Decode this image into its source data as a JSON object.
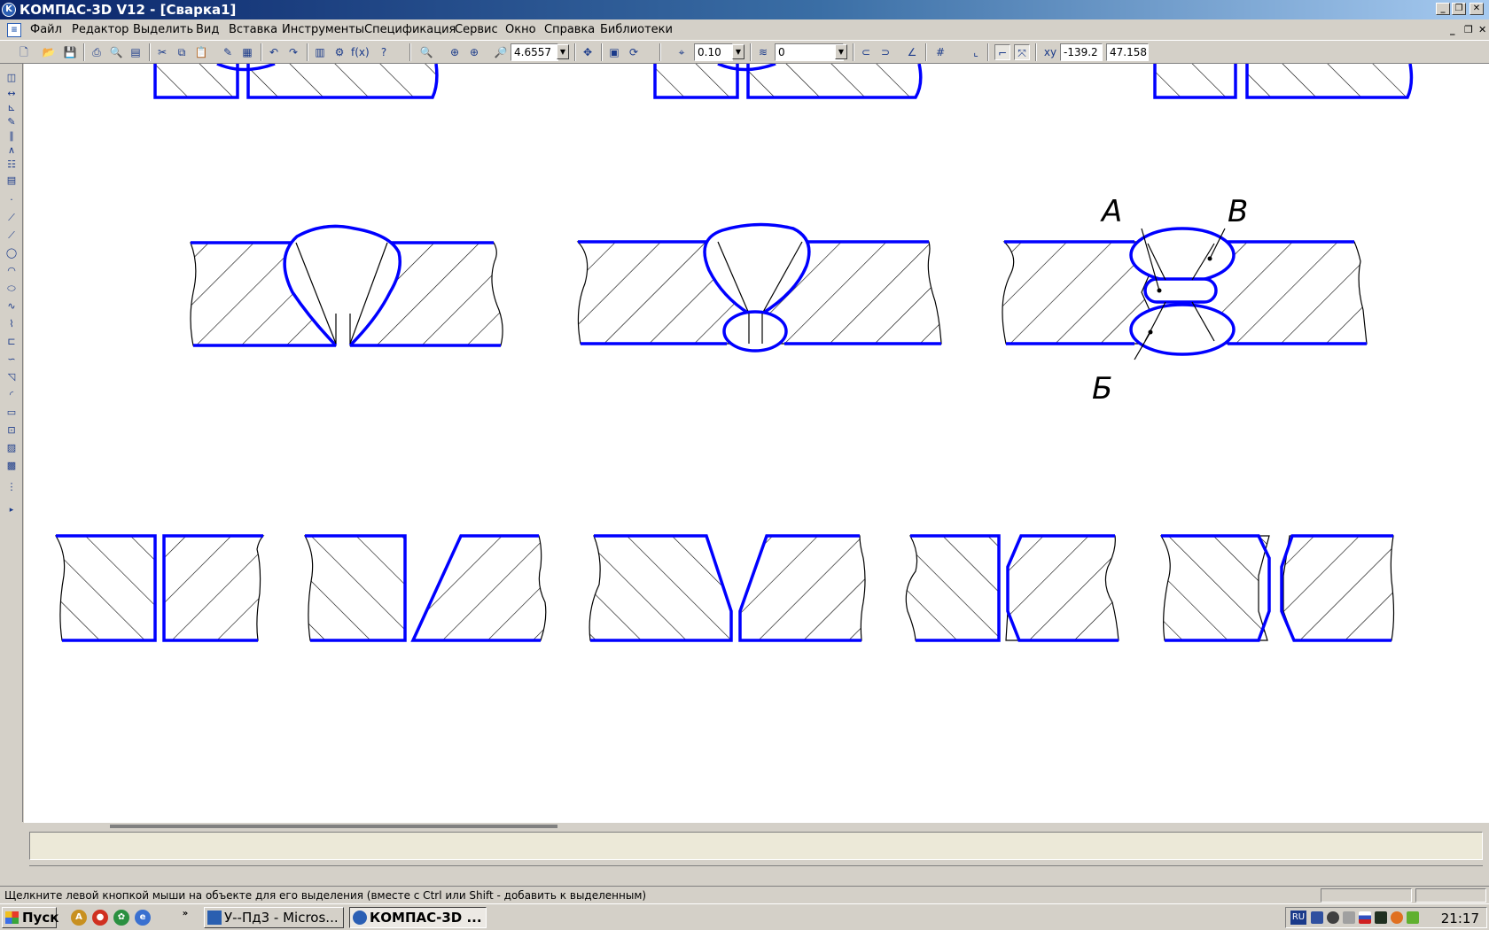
{
  "window": {
    "title": "КОМПАС-3D V12 - [Сварка1]",
    "app_icon": "kompas-logo-icon",
    "controls": [
      "minimize-icon",
      "restore-icon",
      "close-icon"
    ]
  },
  "menu": {
    "items": [
      "Файл",
      "Редактор",
      "Выделить",
      "Вид",
      "Вставка",
      "Инструменты",
      "Спецификация",
      "Сервис",
      "Окно",
      "Справка",
      "Библиотеки"
    ],
    "mdi_controls": [
      "minimize-icon",
      "restore-icon",
      "close-icon"
    ]
  },
  "toolbar": {
    "zoom_value": "4.6557",
    "step_value": "0.10",
    "layer_value": "0",
    "coord_x": "-139.2",
    "coord_y": "47.158"
  },
  "drawing": {
    "label_a": "А",
    "label_b": "Б",
    "label_v": "В",
    "line_color": "#0000ff",
    "hatch_color": "#000000"
  },
  "status": {
    "hint": "Щелкните левой кнопкой мыши на объекте для его выделения (вместе с Ctrl или Shift - добавить к выделенным)"
  },
  "taskbar": {
    "start_label": "Пуск",
    "more_label": "»",
    "tasks": [
      {
        "label": "У--Пд3 - Micros...",
        "icon": "word-icon",
        "active": false
      },
      {
        "label": "КОМПАС-3D ...",
        "icon": "kompas-logo-icon",
        "active": true
      }
    ],
    "lang": "RU",
    "clock": "21:17"
  }
}
